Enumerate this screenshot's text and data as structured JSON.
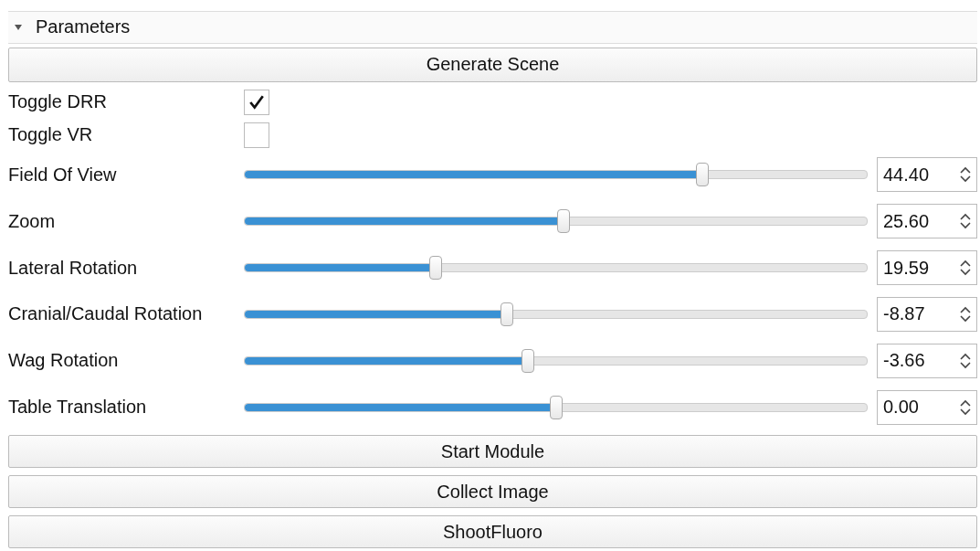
{
  "section": {
    "title": "Parameters",
    "expanded": true
  },
  "generate_button": "Generate Scene",
  "toggles": [
    {
      "label": "Toggle DRR",
      "checked": true
    },
    {
      "label": "Toggle VR",
      "checked": false
    }
  ],
  "sliders": [
    {
      "label": "Field Of View",
      "level": 0.735,
      "value": "44.40"
    },
    {
      "label": "Zoom",
      "level": 0.513,
      "value": "25.60"
    },
    {
      "label": "Lateral Rotation",
      "level": 0.308,
      "value": "19.59"
    },
    {
      "label": "Cranial/Caudal Rotation",
      "level": 0.421,
      "value": "-8.87"
    },
    {
      "label": "Wag Rotation",
      "level": 0.455,
      "value": "-3.66"
    },
    {
      "label": "Table Translation",
      "level": 0.5,
      "value": "0.00"
    }
  ],
  "buttons": [
    "Start Module",
    "Collect Image",
    "ShootFluoro"
  ]
}
